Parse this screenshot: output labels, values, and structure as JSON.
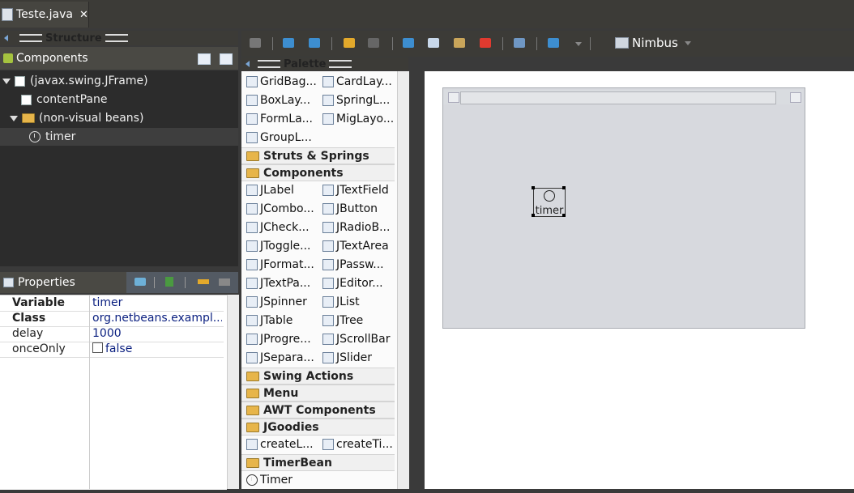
{
  "editor_tab": {
    "label": "Teste.java",
    "close": "✕"
  },
  "structure": {
    "title": "Structure",
    "components_header": "Components",
    "tree": [
      {
        "label": "(javax.swing.JFrame)"
      },
      {
        "label": "contentPane"
      },
      {
        "label": "(non-visual beans)"
      },
      {
        "label": "timer"
      }
    ]
  },
  "properties": {
    "header": "Properties",
    "rows": [
      {
        "key": "Variable",
        "value": "timer"
      },
      {
        "key": "Class",
        "value": "org.netbeans.exampl..."
      },
      {
        "key": "delay",
        "value": "1000"
      },
      {
        "key": "onceOnly",
        "value": "false"
      }
    ]
  },
  "toolbar": {
    "laf": "Nimbus"
  },
  "palette": {
    "title": "Palette",
    "layouts": [
      "GridBag...",
      "CardLay...",
      "BoxLay...",
      "SpringL...",
      "FormLa...",
      "MigLayo...",
      "GroupL..."
    ],
    "cat_struts": "Struts & Springs",
    "cat_components": "Components",
    "components": [
      "JLabel",
      "JTextField",
      "JCombo...",
      "JButton",
      "JCheck...",
      "JRadioB...",
      "JToggle...",
      "JTextArea",
      "JFormat...",
      "JPassw...",
      "JTextPa...",
      "JEditor...",
      "JSpinner",
      "JList",
      "JTable",
      "JTree",
      "JProgre...",
      "JScrollBar",
      "JSepara...",
      "JSlider"
    ],
    "cat_swing_actions": "Swing Actions",
    "cat_menu": "Menu",
    "cat_awt": "AWT Components",
    "cat_jgoodies": "JGoodies",
    "jgoodies_items": [
      "createL...",
      "createTi..."
    ],
    "cat_timerbean": "TimerBean",
    "timerbean_items": [
      "Timer"
    ]
  },
  "design": {
    "bean_label": "timer"
  }
}
